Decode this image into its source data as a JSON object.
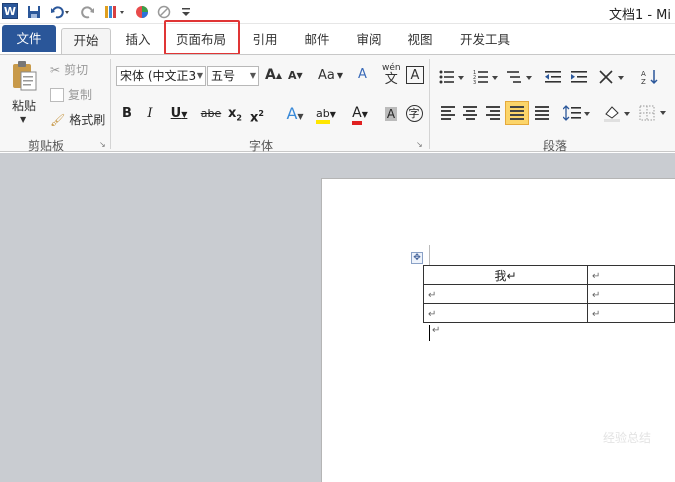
{
  "titlebar": {
    "title": "文档1 - Mi",
    "app_icon_letter": "W"
  },
  "tabs": [
    {
      "label": "文件"
    },
    {
      "label": "开始"
    },
    {
      "label": "插入"
    },
    {
      "label": "页面布局"
    },
    {
      "label": "引用"
    },
    {
      "label": "邮件"
    },
    {
      "label": "审阅"
    },
    {
      "label": "视图"
    },
    {
      "label": "开发工具"
    }
  ],
  "clipboard": {
    "paste_label": "粘贴",
    "cut_label": "剪切",
    "copy_label": "复制",
    "format_painter_label": "格式刷",
    "group_label": "剪贴板"
  },
  "font": {
    "font_name": "宋体 (中文正3",
    "font_size": "五号",
    "grow": "A",
    "shrink": "A",
    "change_case": "Aa",
    "clear_format_glyph": "A",
    "phonetic": "wén",
    "phonetic_char": "文",
    "border_char": "A",
    "bold": "B",
    "italic": "I",
    "underline": "U",
    "strike": "abe",
    "subscript": "x",
    "superscript": "x",
    "effects": "A",
    "highlight": "ab",
    "color": "A",
    "shading": "A",
    "enclose": "字",
    "group_label": "字体"
  },
  "paragraph": {
    "group_label": "段落"
  },
  "colors": {
    "file_tab": "#2a5699",
    "highlight_box": "#e03535",
    "doc_bg": "#c9ccd1"
  },
  "document": {
    "table_rows": [
      [
        "我↵",
        "↵"
      ],
      [
        "↵",
        "↵"
      ],
      [
        "↵",
        "↵"
      ]
    ],
    "after_table_mark": "↵"
  },
  "watermark": "经验总结"
}
